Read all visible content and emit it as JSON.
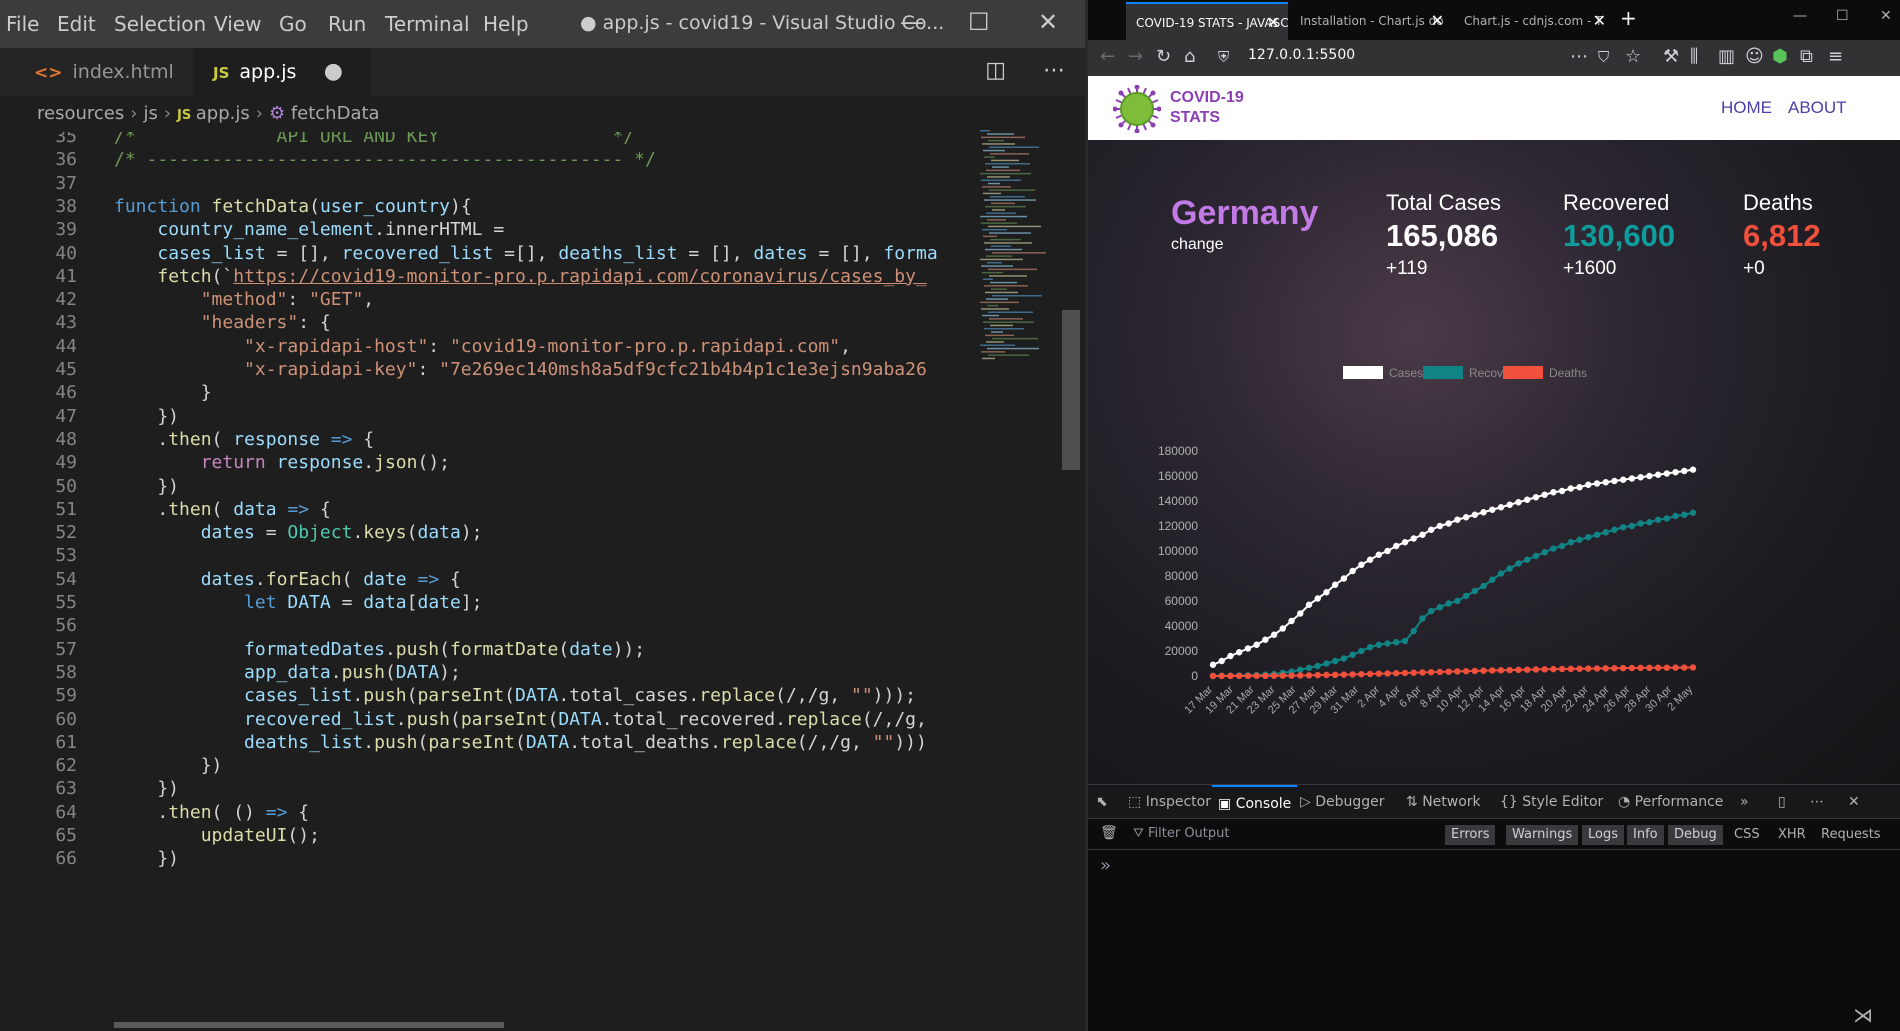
{
  "vscode": {
    "menu": [
      "File",
      "Edit",
      "Selection",
      "View",
      "Go",
      "Run",
      "Terminal",
      "Help"
    ],
    "title": "● app.js - covid19 - Visual Studio Co...",
    "tabs": [
      {
        "label": "index.html",
        "icon": "html-file-icon"
      },
      {
        "label": "app.js",
        "icon": "js-file-icon",
        "modified": "●"
      }
    ],
    "breadcrumb": [
      "resources",
      "js",
      "app.js",
      "fetchData"
    ],
    "code_lines": [
      {
        "n": "35",
        "t": "/*             API URL AND KEY                */"
      },
      {
        "n": "36",
        "t": "/* -------------------------------------------- */"
      },
      {
        "n": "37",
        "t": ""
      },
      {
        "n": "38",
        "t": "function fetchData(user_country){"
      },
      {
        "n": "39",
        "t": "    country_name_element.innerHTML ="
      },
      {
        "n": "40",
        "t": "    cases_list = [], recovered_list =[], deaths_list = [], dates = [], forma"
      },
      {
        "n": "41",
        "t": "    fetch(`https://covid19-monitor-pro.p.rapidapi.com/coronavirus/cases_by_"
      },
      {
        "n": "42",
        "t": "        \"method\": \"GET\","
      },
      {
        "n": "43",
        "t": "        \"headers\": {"
      },
      {
        "n": "44",
        "t": "            \"x-rapidapi-host\": \"covid19-monitor-pro.p.rapidapi.com\","
      },
      {
        "n": "45",
        "t": "            \"x-rapidapi-key\": \"7e269ec140msh8a5df9cfc21b4b4p1c1e3ejsn9aba26"
      },
      {
        "n": "46",
        "t": "        }"
      },
      {
        "n": "47",
        "t": "    })"
      },
      {
        "n": "48",
        "t": "    .then( response => {"
      },
      {
        "n": "49",
        "t": "        return response.json();"
      },
      {
        "n": "50",
        "t": "    })"
      },
      {
        "n": "51",
        "t": "    .then( data => {"
      },
      {
        "n": "52",
        "t": "        dates = Object.keys(data);"
      },
      {
        "n": "53",
        "t": ""
      },
      {
        "n": "54",
        "t": "        dates.forEach( date => {"
      },
      {
        "n": "55",
        "t": "            let DATA = data[date];"
      },
      {
        "n": "56",
        "t": ""
      },
      {
        "n": "57",
        "t": "            formatedDates.push(formatDate(date));"
      },
      {
        "n": "58",
        "t": "            app_data.push(DATA);"
      },
      {
        "n": "59",
        "t": "            cases_list.push(parseInt(DATA.total_cases.replace(/,/g, \"\")));"
      },
      {
        "n": "60",
        "t": "            recovered_list.push(parseInt(DATA.total_recovered.replace(/,/g,"
      },
      {
        "n": "61",
        "t": "            deaths_list.push(parseInt(DATA.total_deaths.replace(/,/g, \"\")))"
      },
      {
        "n": "62",
        "t": "        })"
      },
      {
        "n": "63",
        "t": "    })"
      },
      {
        "n": "64",
        "t": "    .then( () => {"
      },
      {
        "n": "65",
        "t": "        updateUI();"
      },
      {
        "n": "66",
        "t": "    })"
      }
    ]
  },
  "firefox": {
    "tabs": [
      {
        "label": "COVID-19 STATS - JAVASCRI",
        "active": true
      },
      {
        "label": "Installation - Chart.js do",
        "active": false
      },
      {
        "label": "Chart.js - cdnjs.com - T",
        "active": false
      }
    ],
    "new_tab": "+",
    "url": "127.0.0.1:5500",
    "page": {
      "logo_text": "COVID-19\nSTATS",
      "nav": [
        "HOME",
        "ABOUT"
      ],
      "country": "Germany",
      "change_label": "change",
      "stats": [
        {
          "label": "Total Cases",
          "value": "165,086",
          "new": "+119",
          "color": "#ffffff"
        },
        {
          "label": "Recovered",
          "value": "130,600",
          "new": "+1600",
          "color": "#0e9c9c"
        },
        {
          "label": "Deaths",
          "value": "6,812",
          "new": "+0",
          "color": "#f0503c"
        }
      ]
    },
    "devtools": {
      "tabs": [
        "Inspector",
        "Console",
        "Debugger",
        "Network",
        "Style Editor",
        "Performance"
      ],
      "active_tab": "Console",
      "filter_placeholder": "Filter Output",
      "filters": [
        "Errors",
        "Warnings",
        "Logs",
        "Info",
        "Debug",
        "CSS",
        "XHR",
        "Requests"
      ],
      "prompt": "»"
    }
  },
  "chart_data": {
    "type": "line",
    "legend": [
      "Cases",
      "Recovered",
      "Deaths"
    ],
    "colors": {
      "Cases": "#ffffff",
      "Recovered": "#118585",
      "Deaths": "#f0503c"
    },
    "ylim": [
      0,
      180000
    ],
    "yticks": [
      "0",
      "20000",
      "40000",
      "60000",
      "80000",
      "100000",
      "120000",
      "140000",
      "160000",
      "180000"
    ],
    "xticks": [
      "17 Mar",
      "19 Mar",
      "21 Mar",
      "23 Mar",
      "25 Mar",
      "27 Mar",
      "29 Mar",
      "31 Mar",
      "2 Apr",
      "4 Apr",
      "6 Apr",
      "8 Apr",
      "10 Apr",
      "12 Apr",
      "14 Apr",
      "16 Apr",
      "18 Apr",
      "20 Apr",
      "22 Apr",
      "24 Apr",
      "26 Apr",
      "28 Apr",
      "30 Apr",
      "2 May"
    ],
    "series": [
      {
        "name": "Cases",
        "values": [
          9000,
          12000,
          16000,
          19000,
          22000,
          25000,
          29000,
          33000,
          38000,
          44000,
          50000,
          57000,
          62000,
          67000,
          73000,
          78000,
          84000,
          89000,
          93000,
          97000,
          100000,
          104000,
          107000,
          110000,
          113000,
          117000,
          120000,
          122000,
          125000,
          127000,
          129000,
          131000,
          133000,
          135000,
          137000,
          139000,
          141000,
          143000,
          145000,
          147000,
          148000,
          150000,
          151000,
          153000,
          154000,
          155000,
          156000,
          157000,
          158000,
          159000,
          160000,
          161000,
          162000,
          163000,
          164000,
          165086
        ]
      },
      {
        "name": "Recovered",
        "values": [
          100,
          200,
          300,
          400,
          500,
          700,
          1000,
          1500,
          2500,
          3500,
          5000,
          6500,
          8000,
          10000,
          12000,
          14000,
          17000,
          20000,
          23000,
          25000,
          26000,
          27000,
          28000,
          36000,
          46000,
          52000,
          55000,
          58000,
          60000,
          64000,
          68000,
          72000,
          77000,
          82000,
          86000,
          90000,
          93000,
          96000,
          99000,
          102000,
          104000,
          107000,
          109000,
          111000,
          113000,
          115000,
          117000,
          119000,
          120000,
          122000,
          123000,
          125000,
          126000,
          128000,
          129000,
          130600
        ]
      },
      {
        "name": "Deaths",
        "values": [
          20,
          30,
          50,
          70,
          90,
          120,
          150,
          200,
          270,
          350,
          450,
          550,
          680,
          800,
          950,
          1100,
          1250,
          1450,
          1650,
          1850,
          2050,
          2250,
          2450,
          2650,
          2850,
          3050,
          3250,
          3450,
          3650,
          3850,
          4050,
          4250,
          4450,
          4600,
          4750,
          4900,
          5050,
          5200,
          5350,
          5500,
          5600,
          5700,
          5800,
          5900,
          6000,
          6100,
          6200,
          6300,
          6400,
          6500,
          6550,
          6600,
          6650,
          6700,
          6750,
          6812
        ]
      }
    ]
  }
}
